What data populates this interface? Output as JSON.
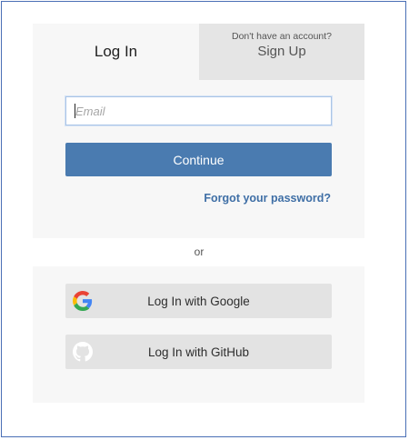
{
  "tabs": {
    "login": {
      "label": "Log In"
    },
    "signup": {
      "prompt": "Don't have an account?",
      "label": "Sign Up"
    }
  },
  "form": {
    "email": {
      "value": "",
      "placeholder": "Email"
    },
    "continue_label": "Continue",
    "forgot_label": "Forgot your password?"
  },
  "divider": {
    "label": "or"
  },
  "social": {
    "google": {
      "label": "Log In with Google",
      "icon": "google-icon"
    },
    "github": {
      "label": "Log In with GitHub",
      "icon": "github-icon"
    }
  },
  "colors": {
    "primary_button": "#4a7bb0",
    "link": "#3f6fa6",
    "frame_border": "#4a6fb5"
  }
}
